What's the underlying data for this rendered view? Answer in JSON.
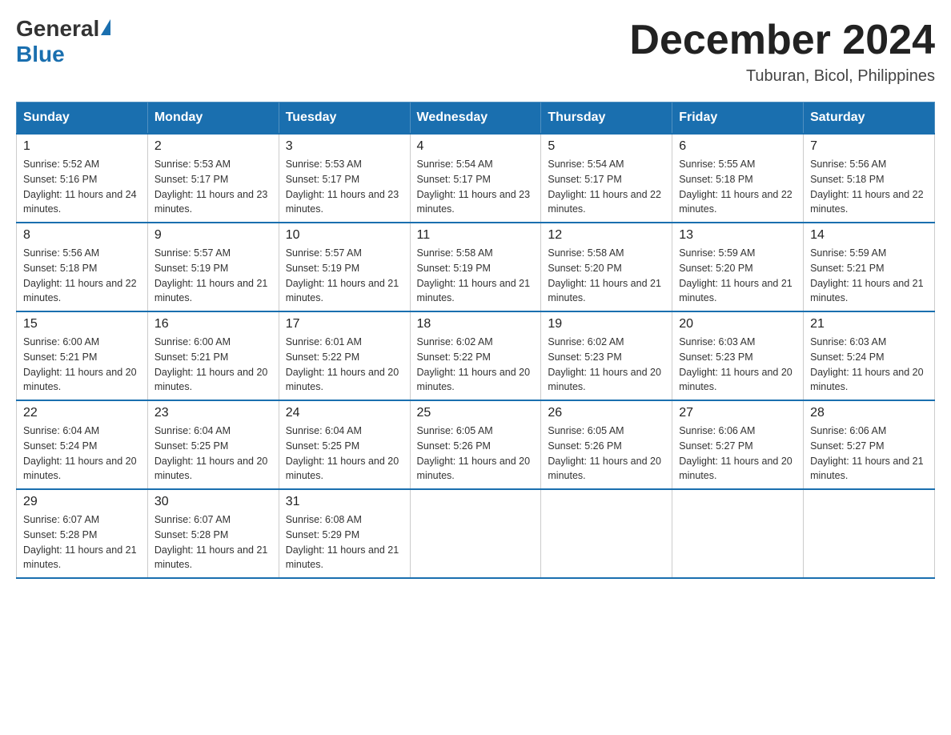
{
  "header": {
    "logo_text_general": "General",
    "logo_text_blue": "Blue",
    "month_title": "December 2024",
    "location": "Tuburan, Bicol, Philippines"
  },
  "calendar": {
    "days_of_week": [
      "Sunday",
      "Monday",
      "Tuesday",
      "Wednesday",
      "Thursday",
      "Friday",
      "Saturday"
    ],
    "weeks": [
      [
        {
          "day": "1",
          "sunrise": "5:52 AM",
          "sunset": "5:16 PM",
          "daylight": "11 hours and 24 minutes."
        },
        {
          "day": "2",
          "sunrise": "5:53 AM",
          "sunset": "5:17 PM",
          "daylight": "11 hours and 23 minutes."
        },
        {
          "day": "3",
          "sunrise": "5:53 AM",
          "sunset": "5:17 PM",
          "daylight": "11 hours and 23 minutes."
        },
        {
          "day": "4",
          "sunrise": "5:54 AM",
          "sunset": "5:17 PM",
          "daylight": "11 hours and 23 minutes."
        },
        {
          "day": "5",
          "sunrise": "5:54 AM",
          "sunset": "5:17 PM",
          "daylight": "11 hours and 22 minutes."
        },
        {
          "day": "6",
          "sunrise": "5:55 AM",
          "sunset": "5:18 PM",
          "daylight": "11 hours and 22 minutes."
        },
        {
          "day": "7",
          "sunrise": "5:56 AM",
          "sunset": "5:18 PM",
          "daylight": "11 hours and 22 minutes."
        }
      ],
      [
        {
          "day": "8",
          "sunrise": "5:56 AM",
          "sunset": "5:18 PM",
          "daylight": "11 hours and 22 minutes."
        },
        {
          "day": "9",
          "sunrise": "5:57 AM",
          "sunset": "5:19 PM",
          "daylight": "11 hours and 21 minutes."
        },
        {
          "day": "10",
          "sunrise": "5:57 AM",
          "sunset": "5:19 PM",
          "daylight": "11 hours and 21 minutes."
        },
        {
          "day": "11",
          "sunrise": "5:58 AM",
          "sunset": "5:19 PM",
          "daylight": "11 hours and 21 minutes."
        },
        {
          "day": "12",
          "sunrise": "5:58 AM",
          "sunset": "5:20 PM",
          "daylight": "11 hours and 21 minutes."
        },
        {
          "day": "13",
          "sunrise": "5:59 AM",
          "sunset": "5:20 PM",
          "daylight": "11 hours and 21 minutes."
        },
        {
          "day": "14",
          "sunrise": "5:59 AM",
          "sunset": "5:21 PM",
          "daylight": "11 hours and 21 minutes."
        }
      ],
      [
        {
          "day": "15",
          "sunrise": "6:00 AM",
          "sunset": "5:21 PM",
          "daylight": "11 hours and 20 minutes."
        },
        {
          "day": "16",
          "sunrise": "6:00 AM",
          "sunset": "5:21 PM",
          "daylight": "11 hours and 20 minutes."
        },
        {
          "day": "17",
          "sunrise": "6:01 AM",
          "sunset": "5:22 PM",
          "daylight": "11 hours and 20 minutes."
        },
        {
          "day": "18",
          "sunrise": "6:02 AM",
          "sunset": "5:22 PM",
          "daylight": "11 hours and 20 minutes."
        },
        {
          "day": "19",
          "sunrise": "6:02 AM",
          "sunset": "5:23 PM",
          "daylight": "11 hours and 20 minutes."
        },
        {
          "day": "20",
          "sunrise": "6:03 AM",
          "sunset": "5:23 PM",
          "daylight": "11 hours and 20 minutes."
        },
        {
          "day": "21",
          "sunrise": "6:03 AM",
          "sunset": "5:24 PM",
          "daylight": "11 hours and 20 minutes."
        }
      ],
      [
        {
          "day": "22",
          "sunrise": "6:04 AM",
          "sunset": "5:24 PM",
          "daylight": "11 hours and 20 minutes."
        },
        {
          "day": "23",
          "sunrise": "6:04 AM",
          "sunset": "5:25 PM",
          "daylight": "11 hours and 20 minutes."
        },
        {
          "day": "24",
          "sunrise": "6:04 AM",
          "sunset": "5:25 PM",
          "daylight": "11 hours and 20 minutes."
        },
        {
          "day": "25",
          "sunrise": "6:05 AM",
          "sunset": "5:26 PM",
          "daylight": "11 hours and 20 minutes."
        },
        {
          "day": "26",
          "sunrise": "6:05 AM",
          "sunset": "5:26 PM",
          "daylight": "11 hours and 20 minutes."
        },
        {
          "day": "27",
          "sunrise": "6:06 AM",
          "sunset": "5:27 PM",
          "daylight": "11 hours and 20 minutes."
        },
        {
          "day": "28",
          "sunrise": "6:06 AM",
          "sunset": "5:27 PM",
          "daylight": "11 hours and 21 minutes."
        }
      ],
      [
        {
          "day": "29",
          "sunrise": "6:07 AM",
          "sunset": "5:28 PM",
          "daylight": "11 hours and 21 minutes."
        },
        {
          "day": "30",
          "sunrise": "6:07 AM",
          "sunset": "5:28 PM",
          "daylight": "11 hours and 21 minutes."
        },
        {
          "day": "31",
          "sunrise": "6:08 AM",
          "sunset": "5:29 PM",
          "daylight": "11 hours and 21 minutes."
        },
        null,
        null,
        null,
        null
      ]
    ]
  }
}
